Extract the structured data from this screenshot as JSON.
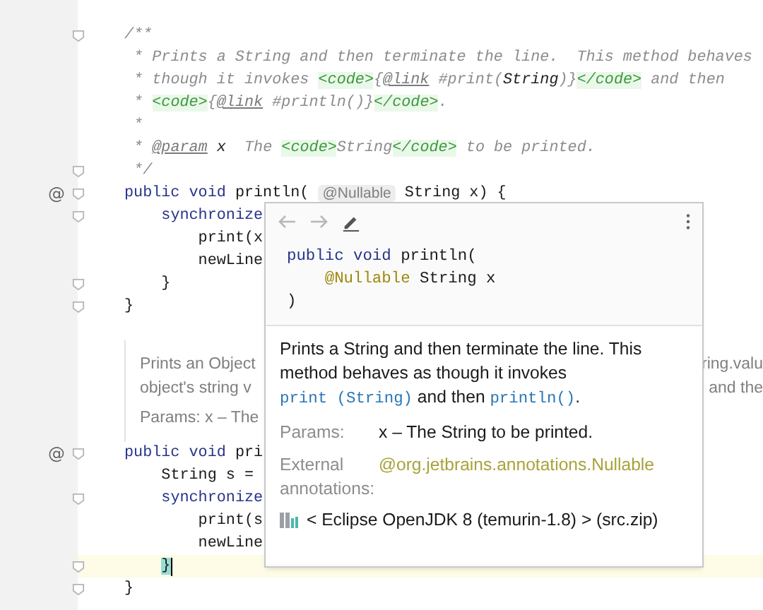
{
  "editor": {
    "top_lines": [
      {
        "fold": true,
        "current": false,
        "caret": false,
        "segments": [
          {
            "text": "/**",
            "kind": "comment"
          }
        ]
      },
      {
        "fold": false,
        "current": false,
        "caret": false,
        "segments": [
          {
            "text": " * Prints a String and then terminate the line.  This method behaves",
            "kind": "comment"
          }
        ]
      },
      {
        "fold": false,
        "current": false,
        "caret": false,
        "segments": [
          {
            "text": " * though it invokes ",
            "kind": "comment"
          },
          {
            "text": "<code>",
            "kind": "tag"
          },
          {
            "text": "{",
            "kind": "comment"
          },
          {
            "text": "@link",
            "kind": "ref"
          },
          {
            "text": " #print(",
            "kind": "comment"
          },
          {
            "text": "String",
            "kind": "ident"
          },
          {
            "text": ")}",
            "kind": "comment"
          },
          {
            "text": "</code>",
            "kind": "tag"
          },
          {
            "text": " and then",
            "kind": "comment"
          }
        ]
      },
      {
        "fold": false,
        "current": false,
        "caret": false,
        "segments": [
          {
            "text": " * ",
            "kind": "comment"
          },
          {
            "text": "<code>",
            "kind": "tag"
          },
          {
            "text": "{",
            "kind": "comment"
          },
          {
            "text": "@link",
            "kind": "ref"
          },
          {
            "text": " #println()}",
            "kind": "comment"
          },
          {
            "text": "</code>",
            "kind": "tag"
          },
          {
            "text": ".",
            "kind": "comment"
          }
        ]
      },
      {
        "fold": false,
        "current": false,
        "caret": false,
        "segments": [
          {
            "text": " *",
            "kind": "comment"
          }
        ]
      },
      {
        "fold": false,
        "current": false,
        "caret": false,
        "segments": [
          {
            "text": " * ",
            "kind": "comment"
          },
          {
            "text": "@param",
            "kind": "ref"
          },
          {
            "text": " x",
            "kind": "ident"
          },
          {
            "text": "  The ",
            "kind": "comment"
          },
          {
            "text": "<code>",
            "kind": "tag"
          },
          {
            "text": "String",
            "kind": "comment"
          },
          {
            "text": "</code>",
            "kind": "tag"
          },
          {
            "text": " to be printed.",
            "kind": "comment"
          }
        ]
      },
      {
        "fold": true,
        "current": false,
        "caret": false,
        "segments": [
          {
            "text": " */",
            "kind": "comment"
          }
        ]
      },
      {
        "gutter": "@",
        "fold": true,
        "current": false,
        "caret": false,
        "segments": [
          {
            "text": "public void ",
            "kind": "keyword"
          },
          {
            "text": "println( ",
            "kind": "plain"
          },
          {
            "text": "@Nullable",
            "kind": "hint"
          },
          {
            "text": " String x) {",
            "kind": "plain"
          }
        ]
      },
      {
        "fold": true,
        "current": false,
        "caret": false,
        "segments": [
          {
            "text": "    synchronize",
            "kind": "keyword"
          }
        ]
      },
      {
        "fold": false,
        "current": false,
        "caret": false,
        "segments": [
          {
            "text": "        print(x",
            "kind": "plain"
          }
        ]
      },
      {
        "fold": false,
        "current": false,
        "caret": false,
        "segments": [
          {
            "text": "        newLine",
            "kind": "plain"
          }
        ]
      },
      {
        "fold": true,
        "current": false,
        "caret": false,
        "segments": [
          {
            "text": "    }",
            "kind": "plain"
          }
        ]
      },
      {
        "fold": true,
        "current": false,
        "caret": false,
        "segments": [
          {
            "text": "}",
            "kind": "plain"
          }
        ]
      }
    ],
    "rendered_doc": [
      {
        "text": "Prints an Object",
        "tail": "ring.valu",
        "kind": "text"
      },
      {
        "text": "object's string v",
        "tail": "and the",
        "kind": "text"
      },
      {
        "text": "Params: x – The",
        "kind": "params"
      }
    ],
    "bottom_lines": [
      {
        "gutter": "@",
        "fold": true,
        "current": false,
        "caret": false,
        "segments": [
          {
            "text": "public void ",
            "kind": "keyword"
          },
          {
            "text": "pri",
            "kind": "plain"
          }
        ]
      },
      {
        "fold": false,
        "current": false,
        "caret": false,
        "segments": [
          {
            "text": "    String s =",
            "kind": "plain"
          }
        ]
      },
      {
        "fold": true,
        "current": false,
        "caret": false,
        "segments": [
          {
            "text": "    synchronize",
            "kind": "keyword"
          }
        ]
      },
      {
        "fold": false,
        "current": false,
        "caret": false,
        "segments": [
          {
            "text": "        print(s",
            "kind": "plain"
          }
        ]
      },
      {
        "fold": false,
        "current": false,
        "caret": false,
        "segments": [
          {
            "text": "        newLine",
            "kind": "plain"
          }
        ]
      },
      {
        "fold": true,
        "current": true,
        "caret": true,
        "segments": [
          {
            "text": "    }",
            "kind": "brace"
          }
        ]
      },
      {
        "fold": true,
        "current": false,
        "caret": false,
        "segments": [
          {
            "text": "}",
            "kind": "plain"
          }
        ]
      }
    ]
  },
  "popup": {
    "signature": [
      [
        {
          "text": "public void ",
          "kind": "keyword"
        },
        {
          "text": "println(",
          "kind": "plain"
        }
      ],
      [
        {
          "text": "    @Nullable",
          "kind": "annotation"
        },
        {
          "text": " String x",
          "kind": "plain"
        }
      ],
      [
        {
          "text": ")",
          "kind": "plain"
        }
      ]
    ],
    "description": [
      {
        "text": "Prints a String and then terminate the line. This method behaves as though it invokes ",
        "kind": "text"
      },
      {
        "text": "print (String)",
        "kind": "link"
      },
      {
        "text": " and then ",
        "kind": "text"
      },
      {
        "text": "println()",
        "kind": "link"
      },
      {
        "text": ".",
        "kind": "text"
      }
    ],
    "params": [
      {
        "label": "Params:",
        "value": "x – The String to be printed.",
        "kind": "text"
      },
      {
        "label": "External annotations:",
        "value": "@org.jetbrains.annotations.Nullable",
        "kind": "annotation"
      }
    ],
    "library": "< Eclipse OpenJDK 8 (temurin-1.8) > (src.zip)"
  }
}
